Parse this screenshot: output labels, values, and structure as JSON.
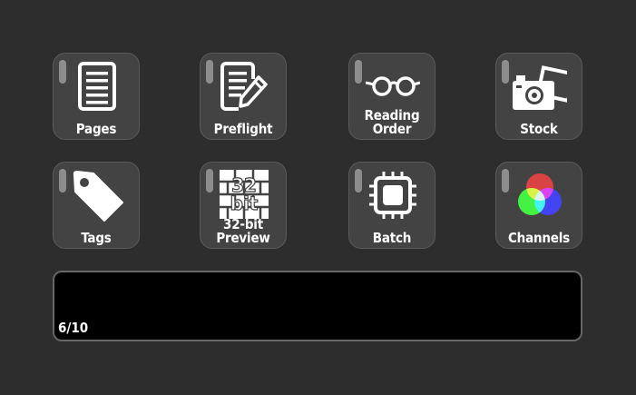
{
  "tiles": [
    {
      "label": "Pages",
      "icon": "document-icon"
    },
    {
      "label": "Preflight",
      "icon": "document-pencil-icon"
    },
    {
      "label": "Reading\nOrder",
      "icon": "glasses-icon"
    },
    {
      "label": "Stock",
      "icon": "camera-photo-icon"
    },
    {
      "label": "Tags",
      "icon": "tag-icon"
    },
    {
      "label": "32-bit Preview",
      "icon": "32bit-icon"
    },
    {
      "label": "Batch",
      "icon": "chip-icon"
    },
    {
      "label": "Channels",
      "icon": "rgb-channels-icon"
    }
  ],
  "display": {
    "page_indicator": "6/10"
  },
  "icon_text": {
    "bit_top": "32",
    "bit_bottom": "bit"
  },
  "colors": {
    "background": "#2d2d2d",
    "tile": "#434343",
    "red": "#cc0000",
    "green": "#00cc00",
    "blue": "#0000dd"
  }
}
